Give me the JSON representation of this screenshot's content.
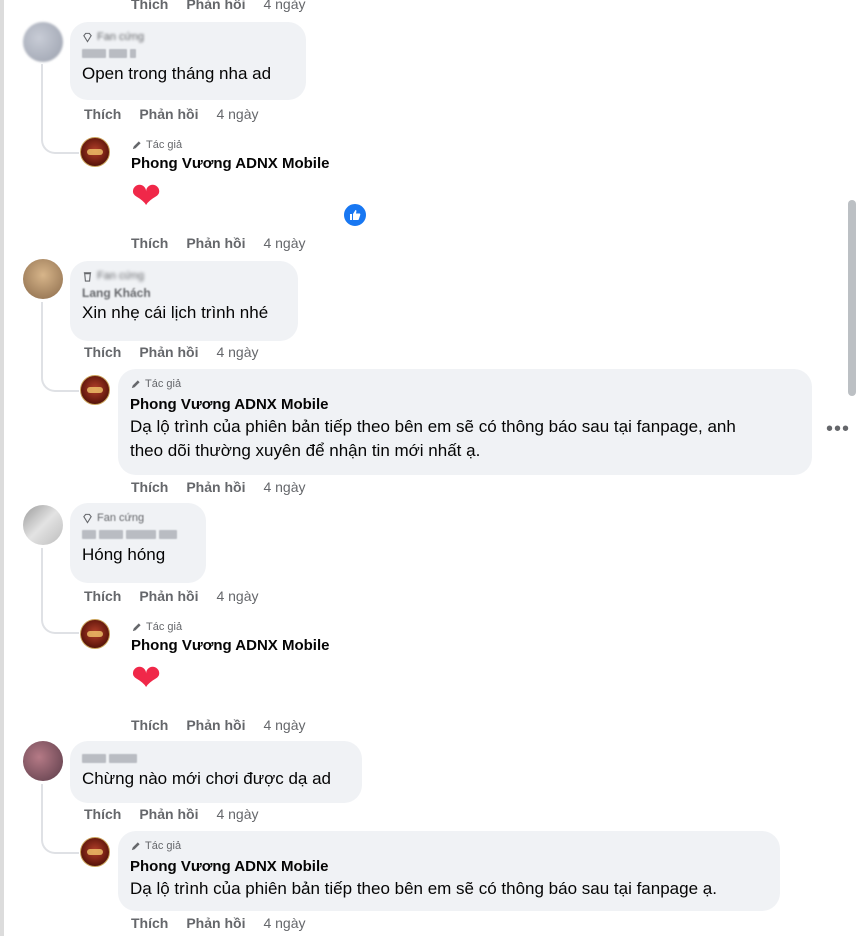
{
  "actions": {
    "like": "Thích",
    "reply": "Phản hồi",
    "time": "4 ngày"
  },
  "author_badge": "Tác giả",
  "page_name": "Phong Vương ADNX Mobile",
  "comments": [
    {
      "badge": "Fan cứng",
      "text": "Open trong tháng nha ad",
      "reply": {
        "type": "heart",
        "glyph": "❤"
      }
    },
    {
      "badge": "Fan cứng",
      "name": "Lang Khách",
      "text": "Xin nhẹ cái lịch trình nhé",
      "reply": {
        "type": "text",
        "lines": [
          "Dạ lộ trình của phiên bản tiếp theo bên em sẽ có thông báo sau tại fanpage, anh",
          "theo dõi thường xuyên để nhận tin mới nhất ạ."
        ]
      }
    },
    {
      "badge": "Fan cứng",
      "text": "Hóng hóng",
      "reply": {
        "type": "heart",
        "glyph": "❤"
      }
    },
    {
      "text": "Chừng nào mới chơi được dạ ad",
      "reply": {
        "type": "text",
        "lines": [
          "Dạ lộ trình của phiên bản tiếp theo bên em sẽ có thông báo sau tại fanpage ạ."
        ]
      }
    }
  ],
  "more_glyph": "•••",
  "colors": {
    "accent": "#1877f2",
    "heart": "#f02849",
    "bubble": "#f0f2f5",
    "meta": "#65676b"
  }
}
